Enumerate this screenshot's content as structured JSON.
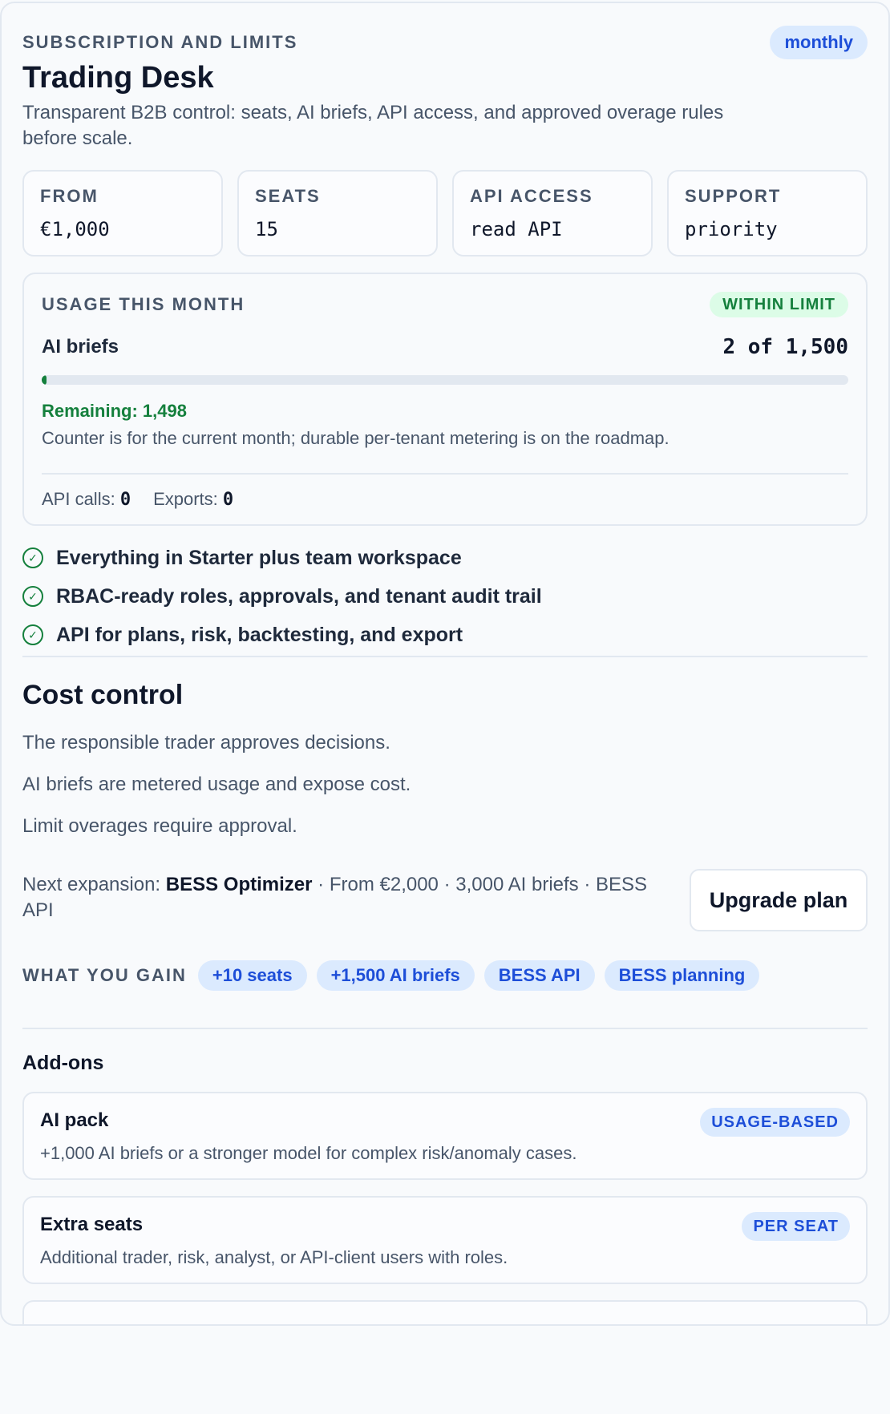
{
  "header": {
    "eyebrow": "Subscription and limits",
    "title": "Trading Desk",
    "subtitle": "Transparent B2B control: seats, AI briefs, API access, and approved overage rules before scale.",
    "billing_cycle": "monthly"
  },
  "stats": [
    {
      "label": "From",
      "value": "€1,000"
    },
    {
      "label": "Seats",
      "value": "15"
    },
    {
      "label": "API access",
      "value": "read API"
    },
    {
      "label": "Support",
      "value": "priority"
    }
  ],
  "usage": {
    "title": "Usage this month",
    "status": "WITHIN LIMIT",
    "metric": "AI briefs",
    "count": "2 of 1,500",
    "used_fraction": 0.0013,
    "remaining": "Remaining: 1,498",
    "note": "Counter is for the current month; durable per-tenant metering is on the roadmap.",
    "api_calls_label": "API calls:",
    "api_calls_value": "0",
    "exports_label": "Exports:",
    "exports_value": "0"
  },
  "features": [
    "Everything in Starter plus team workspace",
    "RBAC-ready roles, approvals, and tenant audit trail",
    "API for plans, risk, backtesting, and export"
  ],
  "cost_control": {
    "title": "Cost control",
    "notes": [
      "The responsible trader approves decisions.",
      "AI briefs are metered usage and expose cost.",
      "Limit overages require approval."
    ]
  },
  "expansion": {
    "prefix": "Next expansion:",
    "plan": "BESS Optimizer",
    "details": "· From €2,000 · 3,000 AI briefs · BESS API",
    "button": "Upgrade plan"
  },
  "gain": {
    "label": "What you gain",
    "chips": [
      "+10 seats",
      "+1,500 AI briefs",
      "BESS API",
      "BESS planning"
    ]
  },
  "addons": {
    "title": "Add-ons",
    "items": [
      {
        "name": "AI pack",
        "badge": "USAGE-BASED",
        "desc": "+1,000 AI briefs or a stronger model for complex risk/anomaly cases."
      },
      {
        "name": "Extra seats",
        "badge": "PER SEAT",
        "desc": "Additional trader, risk, analyst, or API-client users with roles."
      }
    ]
  },
  "colors": {
    "accent": "#1d4ed8",
    "accent_bg": "#dbeafe",
    "success": "#15803d",
    "success_bg": "#dcfce7",
    "border": "#e2e8f0",
    "muted_text": "#475569"
  }
}
